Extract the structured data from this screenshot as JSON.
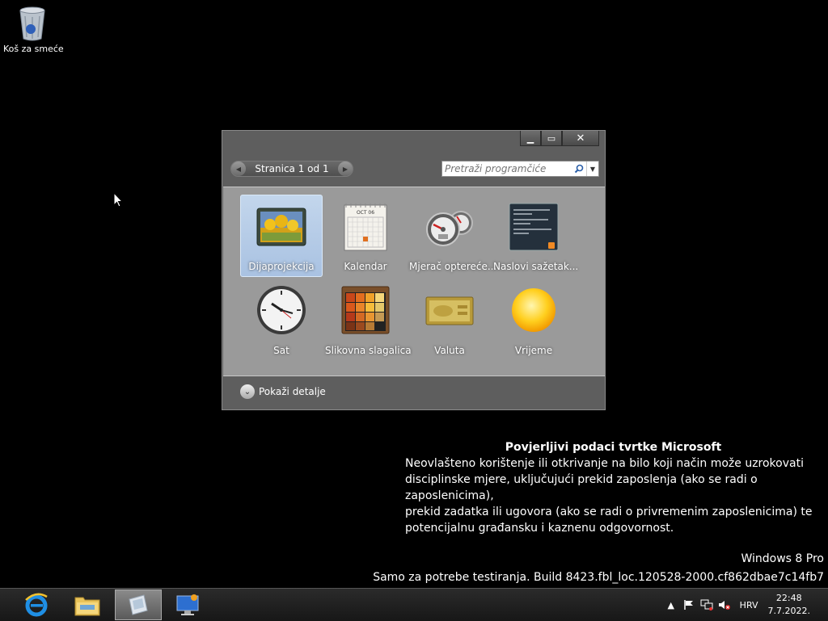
{
  "desktop": {
    "recycle_bin_label": "Koš za smeće"
  },
  "gadgets_window": {
    "pager_text": "Stranica 1 od 1",
    "search_placeholder": "Pretraži programčiće",
    "gadgets": [
      {
        "label": "Dijaprojekcija",
        "icon": "slideshow-icon",
        "selected": true
      },
      {
        "label": "Kalendar",
        "icon": "calendar-icon",
        "selected": false
      },
      {
        "label": "Mjerač optereće...",
        "icon": "cpu-meter-icon",
        "selected": false
      },
      {
        "label": "Naslovi sažetak...",
        "icon": "feed-headlines-icon",
        "selected": false
      },
      {
        "label": "Sat",
        "icon": "clock-icon",
        "selected": false
      },
      {
        "label": "Slikovna slagalica",
        "icon": "picture-puzzle-icon",
        "selected": false
      },
      {
        "label": "Valuta",
        "icon": "currency-icon",
        "selected": false
      },
      {
        "label": "Vrijeme",
        "icon": "weather-icon",
        "selected": false
      }
    ],
    "show_details_label": "Pokaži detalje",
    "calendar_month": "OCT 06"
  },
  "notice": {
    "title": "Povjerljivi podaci tvrtke Microsoft",
    "line1": "Neovlašteno korištenje ili otkrivanje na bilo koji način može uzrokovati",
    "line2": "disciplinske mjere, uključujući prekid zaposlenja (ako se radi o zaposlenicima),",
    "line3": "prekid zadatka ili ugovora (ako se radi o privremenim zaposlenicima) te",
    "line4": "potencijalnu građansku i kaznenu odgovornost."
  },
  "watermark": {
    "edition": "Windows 8 Pro",
    "build": "Samo za potrebe testiranja. Build 8423.fbl_loc.120528-2000.cf862dbae7c14fb7"
  },
  "taskbar": {
    "language": "HRV",
    "time": "22:48",
    "date": "7.7.2022."
  }
}
